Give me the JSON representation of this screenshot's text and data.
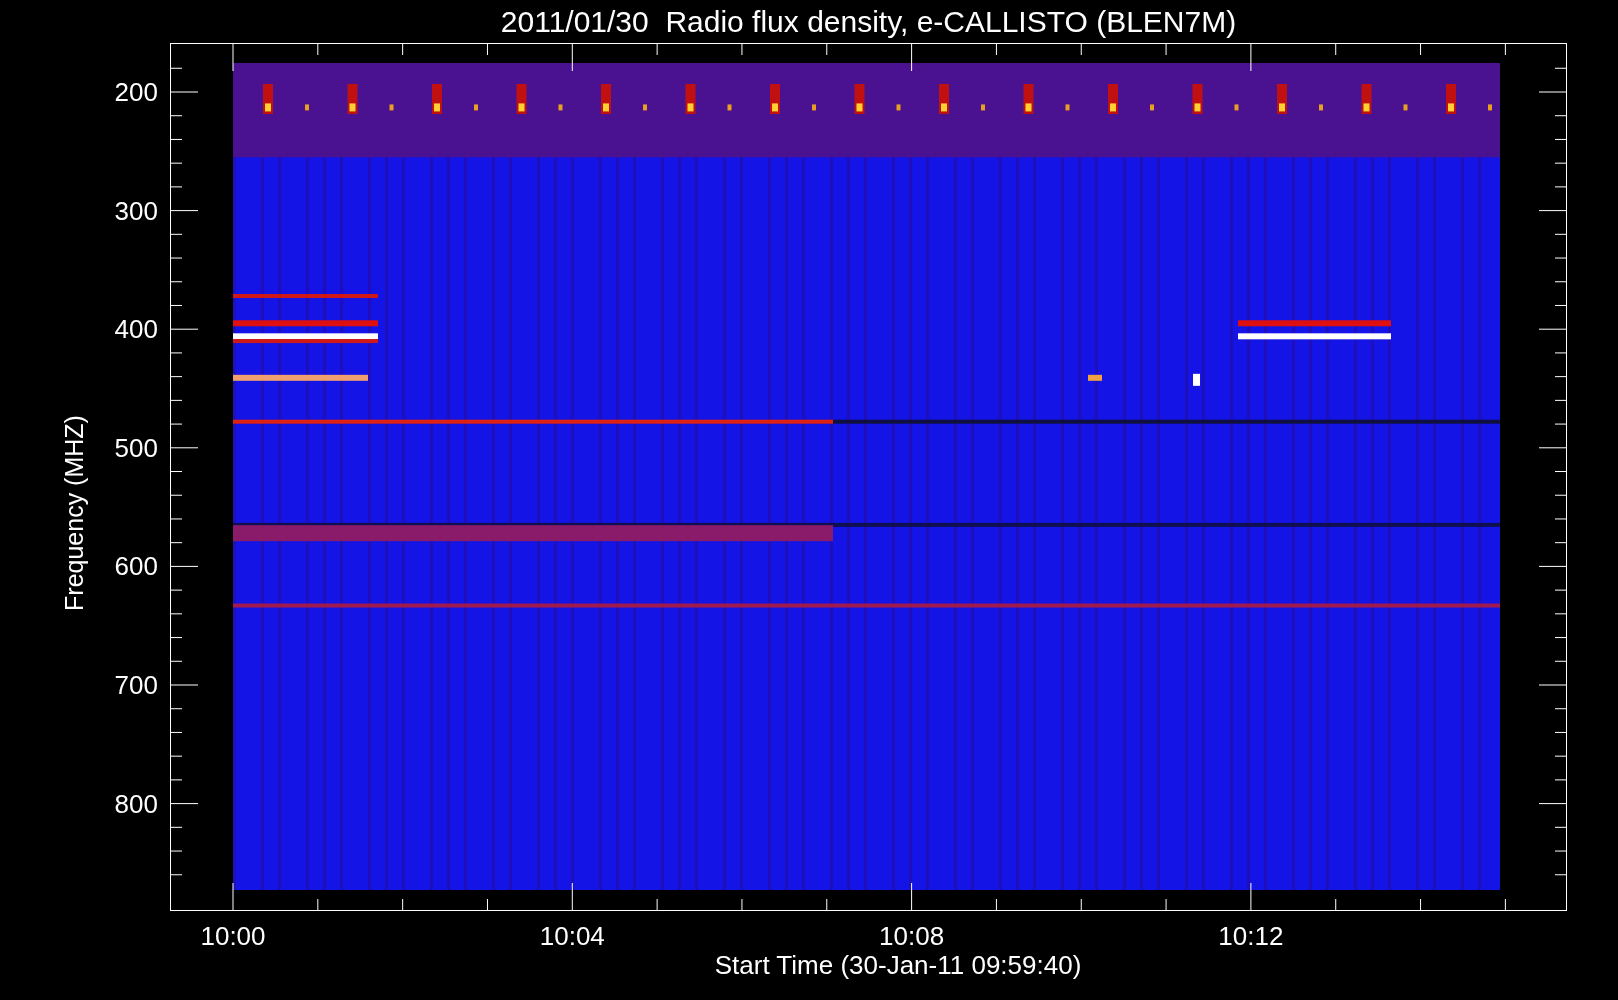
{
  "title": "2011/01/30  Radio flux density, e-CALLISTO (BLEN7M)",
  "y_axis": {
    "label": "Frequency (MHZ)",
    "ticks": [
      "200",
      "300",
      "400",
      "500",
      "600",
      "700",
      "800"
    ]
  },
  "x_axis": {
    "label": "Start Time (30-Jan-11 09:59:40)",
    "ticks": [
      "10:00",
      "10:04",
      "10:08",
      "10:12"
    ]
  }
}
